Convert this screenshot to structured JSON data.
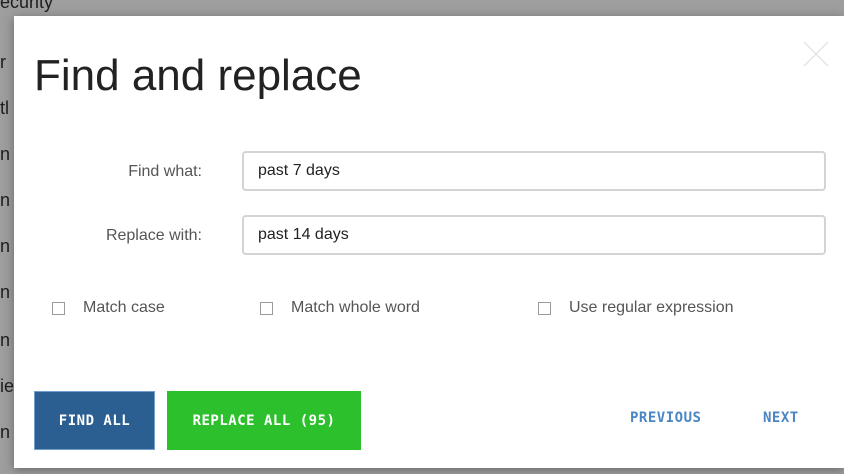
{
  "background": {
    "top_fragment": "ecurity",
    "left_fragments": [
      "r",
      "tl",
      "n",
      "n",
      "n",
      "n",
      "n",
      "ie",
      "n",
      "n"
    ]
  },
  "dialog": {
    "title": "Find and replace",
    "close_icon": "close-x-icon",
    "find_label": "Find what:",
    "find_value": "past 7 days",
    "replace_label": "Replace with:",
    "replace_value": "past 14 days",
    "options": {
      "match_case": "Match case",
      "match_whole_word": "Match whole word",
      "use_regex": "Use regular expression"
    },
    "buttons": {
      "find_all": "FIND ALL",
      "replace_all": "REPLACE ALL (95)",
      "previous": "PREVIOUS",
      "next": "NEXT"
    }
  },
  "colors": {
    "find_all_bg": "#2c5f91",
    "replace_all_bg": "#2dc02d",
    "link_color": "#4a86c4"
  }
}
